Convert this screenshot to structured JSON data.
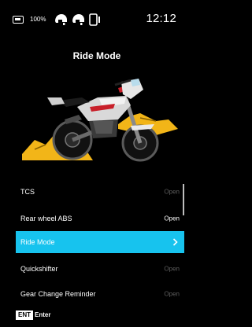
{
  "status_bar": {
    "battery": "100%",
    "time": "12:12",
    "icons": [
      "battery-icon",
      "rider-helmet-icon",
      "passenger-helmet-icon",
      "phone-icon"
    ]
  },
  "screen": {
    "title": "Ride Mode"
  },
  "menu": {
    "items": [
      {
        "label": "TCS",
        "status": "Open",
        "selected": false
      },
      {
        "label": "Rear wheel ABS",
        "status": "Open",
        "selected": false
      },
      {
        "label": "Ride Mode",
        "status": "",
        "selected": true
      },
      {
        "label": "Quickshifter",
        "status": "Open",
        "selected": false
      },
      {
        "label": "Gear Change Reminder",
        "status": "Open",
        "selected": false
      }
    ]
  },
  "footer": {
    "ent_badge": "ENT",
    "enter_label": "Enter"
  },
  "colors": {
    "background": "#000000",
    "selection": "#17c3ee",
    "terrain": "#f2b518"
  }
}
